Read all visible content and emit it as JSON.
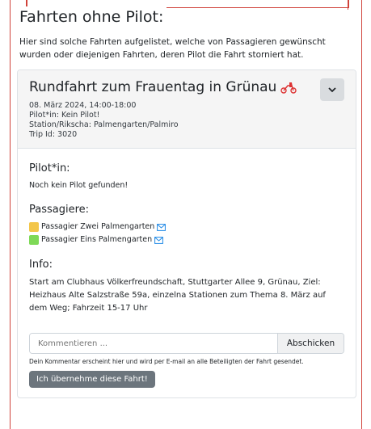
{
  "section": {
    "title": "Fahrten ohne Pilot:",
    "intro": "Hier sind solche Fahrten aufgelistet, welche von Passagieren gewünscht wurden oder diejenigen Fahrten, deren Pilot die Fahrt storniert hat."
  },
  "trip": {
    "title": "Rundfahrt zum Frauentag in Grünau",
    "date": "08. März 2024, 14:00-18:00",
    "pilot_line": "Pilot*in: Kein Pilot!",
    "station_line": "Station/Rikscha: Palmengarten/Palmiro",
    "trip_id_line": "Trip Id: 3020",
    "icons": {
      "bike": "rickshaw-icon",
      "toggle": "chevron-down-icon"
    }
  },
  "body": {
    "pilot_heading": "Pilot*in:",
    "pilot_text": "Noch kein Pilot gefunden!",
    "passengers_heading": "Passagiere:",
    "passengers": [
      {
        "name": "Passagier Zwei Palmengarten"
      },
      {
        "name": "Passagier Eins Palmengarten"
      }
    ],
    "info_heading": "Info:",
    "info_text": "Start am Clubhaus Völkerfreundschaft, Stuttgarter Allee 9, Grünau, Ziel: Heizhaus Alte Salzstraße 59a, einzelna Stationen zum Thema 8. März auf dem Weg; Fahrzeit 15-17 Uhr"
  },
  "comment": {
    "placeholder": "Kommentieren ...",
    "submit_label": "Abschicken",
    "hint": "Dein Kommentar erscheint hier und wird per E-mail an alle Beteiligten der Fahrt gesendet."
  },
  "take_button_label": "Ich übernehme diese Fahrt!",
  "colors": {
    "frame": "#d0423a",
    "mail": "#1e88e5",
    "take_button": "#6c757d"
  }
}
